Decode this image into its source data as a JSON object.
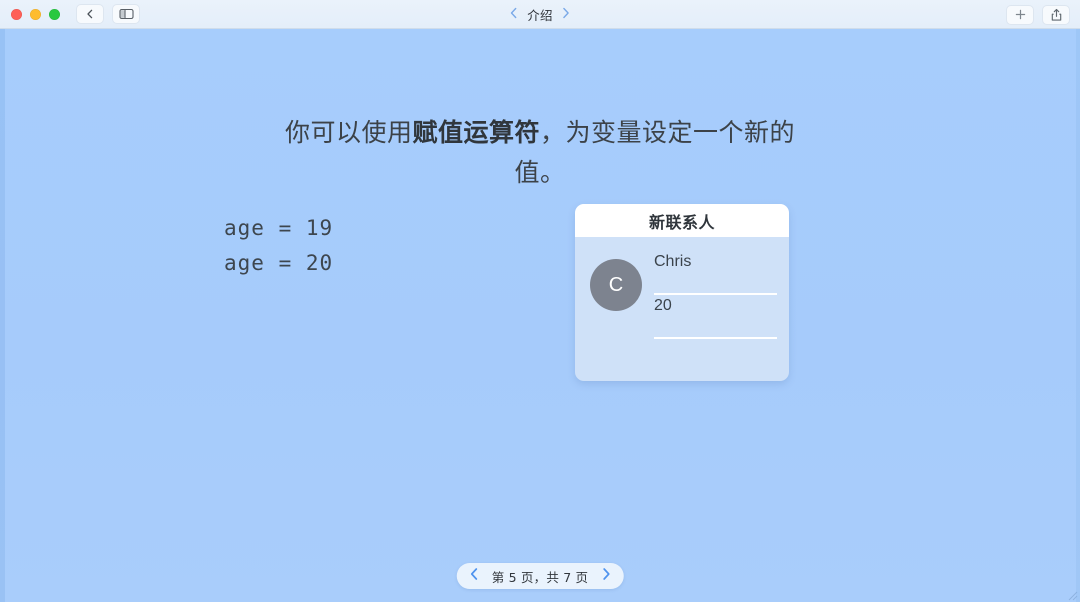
{
  "window": {
    "traffic_lights": [
      "close",
      "minimize",
      "maximize"
    ],
    "back_button_icon": "chevron-left-icon",
    "sidebar_toggle_icon": "sidebar-panel-icon",
    "title": "介绍",
    "prev_doc_icon": "chevron-left-icon",
    "next_doc_icon": "chevron-right-icon",
    "add_button_icon": "plus-icon",
    "share_button_icon": "share-icon"
  },
  "slide": {
    "heading": {
      "part1": "你可以使用",
      "emphasis": "赋值运算符",
      "part2": "，为变量设定一个新的值。"
    },
    "code": "age = 19\nage = 20",
    "contact_card": {
      "header_title": "新联系人",
      "avatar_initial": "C",
      "fields": [
        {
          "value": "Chris"
        },
        {
          "value": "20"
        },
        {
          "value": ""
        }
      ]
    }
  },
  "pagination": {
    "prev_icon": "chevron-left-icon",
    "next_icon": "chevron-right-icon",
    "label": "第 5 页，共 7 页",
    "current_page": 5,
    "total_pages": 7
  },
  "colors": {
    "canvas_background": "#a6cbfb",
    "toolbar_background": "#e8f1fb",
    "card_body": "#cfe1f8",
    "card_header": "#ffffff",
    "avatar": "#7d838f",
    "accent_chevron": "#5b9bf0",
    "text_primary": "#3c4248"
  }
}
